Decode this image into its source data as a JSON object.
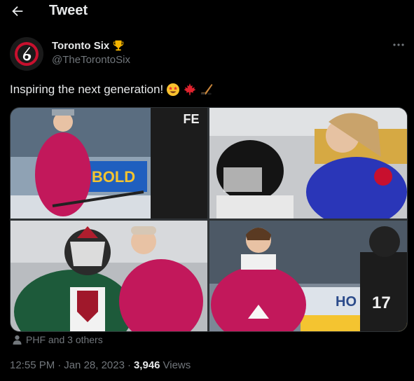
{
  "header": {
    "title": "Tweet",
    "back_icon": "arrow-left-icon"
  },
  "author": {
    "display_name": "Toronto Six",
    "badge_emoji": "trophy",
    "handle": "@TheTorontoSix",
    "avatar": "toronto-six-logo"
  },
  "tweet": {
    "text": "Inspiring the next generation!",
    "emojis": [
      "star-struck-face",
      "maple-leaf",
      "hockey-stick-and-puck"
    ]
  },
  "media": {
    "photos": [
      {
        "description": "player-in-pink-jersey-smiling",
        "banner_text": "BOLD",
        "jersey_text": "FE"
      },
      {
        "description": "player-helping-child-in-helmet"
      },
      {
        "description": "goalie-and-player-laughing"
      },
      {
        "description": "player-in-pink-jersey-hoodie",
        "banner_text": "HO",
        "jersey_number": "17"
      }
    ]
  },
  "tagged": {
    "text": "PHF and 3 others"
  },
  "meta": {
    "time": "12:55 PM",
    "separator": "·",
    "date": "Jan 28, 2023",
    "views_count": "3,946",
    "views_label": "Views"
  },
  "colors": {
    "background": "#000000",
    "text_primary": "#e7e9ea",
    "text_secondary": "#71767b",
    "brand_red": "#c8102e",
    "jersey_pink": "#c2185b"
  }
}
